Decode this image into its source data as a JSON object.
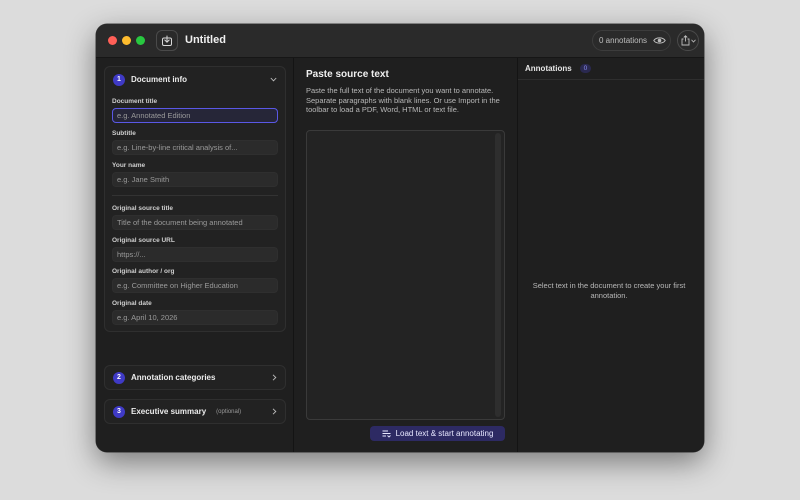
{
  "window": {
    "title": "Untitled"
  },
  "toolbar": {
    "import_icon": "import-icon",
    "annotations_count_label": "0 annotations",
    "eye_icon": "eye-icon",
    "share_icon": "share-icon"
  },
  "sections": {
    "document_info": {
      "number": "1",
      "title": "Document info",
      "fields": {
        "document_title": {
          "label": "Document title",
          "placeholder": "e.g. Annotated Edition"
        },
        "subtitle": {
          "label": "Subtitle",
          "placeholder": "e.g. Line-by-line critical analysis of..."
        },
        "your_name": {
          "label": "Your name",
          "placeholder": "e.g. Jane Smith"
        },
        "original_source_title": {
          "label": "Original source title",
          "placeholder": "Title of the document being annotated"
        },
        "original_source_url": {
          "label": "Original source URL",
          "placeholder": "https://..."
        },
        "original_author": {
          "label": "Original author / org",
          "placeholder": "e.g. Committee on Higher Education"
        },
        "original_date": {
          "label": "Original date",
          "placeholder": "e.g. April 10, 2026"
        }
      }
    },
    "annotation_categories": {
      "number": "2",
      "title": "Annotation categories"
    },
    "executive_summary": {
      "number": "3",
      "title": "Executive summary",
      "optional": "(optional)"
    }
  },
  "source": {
    "title": "Paste source text",
    "help": "Paste the full text of the document you want to annotate. Separate paragraphs with blank lines. Or use Import in the toolbar to load a PDF, Word, HTML or text file.",
    "load_button": "Load text & start annotating"
  },
  "annotations_panel": {
    "title": "Annotations",
    "count": "0",
    "empty_message": "Select text in the document to create your first annotation."
  },
  "colors": {
    "accent": "#3f3ac6",
    "focus": "#5a58e6"
  }
}
